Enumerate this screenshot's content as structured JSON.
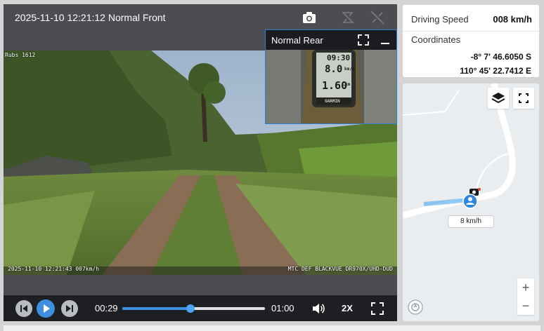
{
  "front": {
    "title": "2025-11-10 12:21:12 Normal Front",
    "osd_top_left": "Rubs 1612",
    "osd_bottom_left": "2025-11-10 12:21:43 007km/h",
    "osd_bottom_right": "MTC DEF BLACKVUE DR970X/UHD-DUD"
  },
  "rear": {
    "title": "Normal Rear",
    "gps_time": "09:30",
    "gps_speed": "8.0",
    "gps_unit": "km/h",
    "gps_dist": "1.60",
    "gps_dist_unit": "km",
    "gps_brand": "GARMIN"
  },
  "controls": {
    "current_time": "00:29",
    "total_time": "01:00",
    "progress": 0.48,
    "playback_speed": "2X"
  },
  "info": {
    "speed_label": "Driving Speed",
    "speed_value": "008 km/h",
    "coords_label": "Coordinates",
    "latitude": "-8° 7' 46.6050 S",
    "longitude": "110° 45' 22.7412 E"
  },
  "map": {
    "vehicle_speed": "8 km/h",
    "zoom_in": "+",
    "zoom_out": "−"
  },
  "colors": {
    "accent": "#3e8fe0",
    "control_bar": "#1e1f22",
    "panel_header": "#4b4d51"
  }
}
